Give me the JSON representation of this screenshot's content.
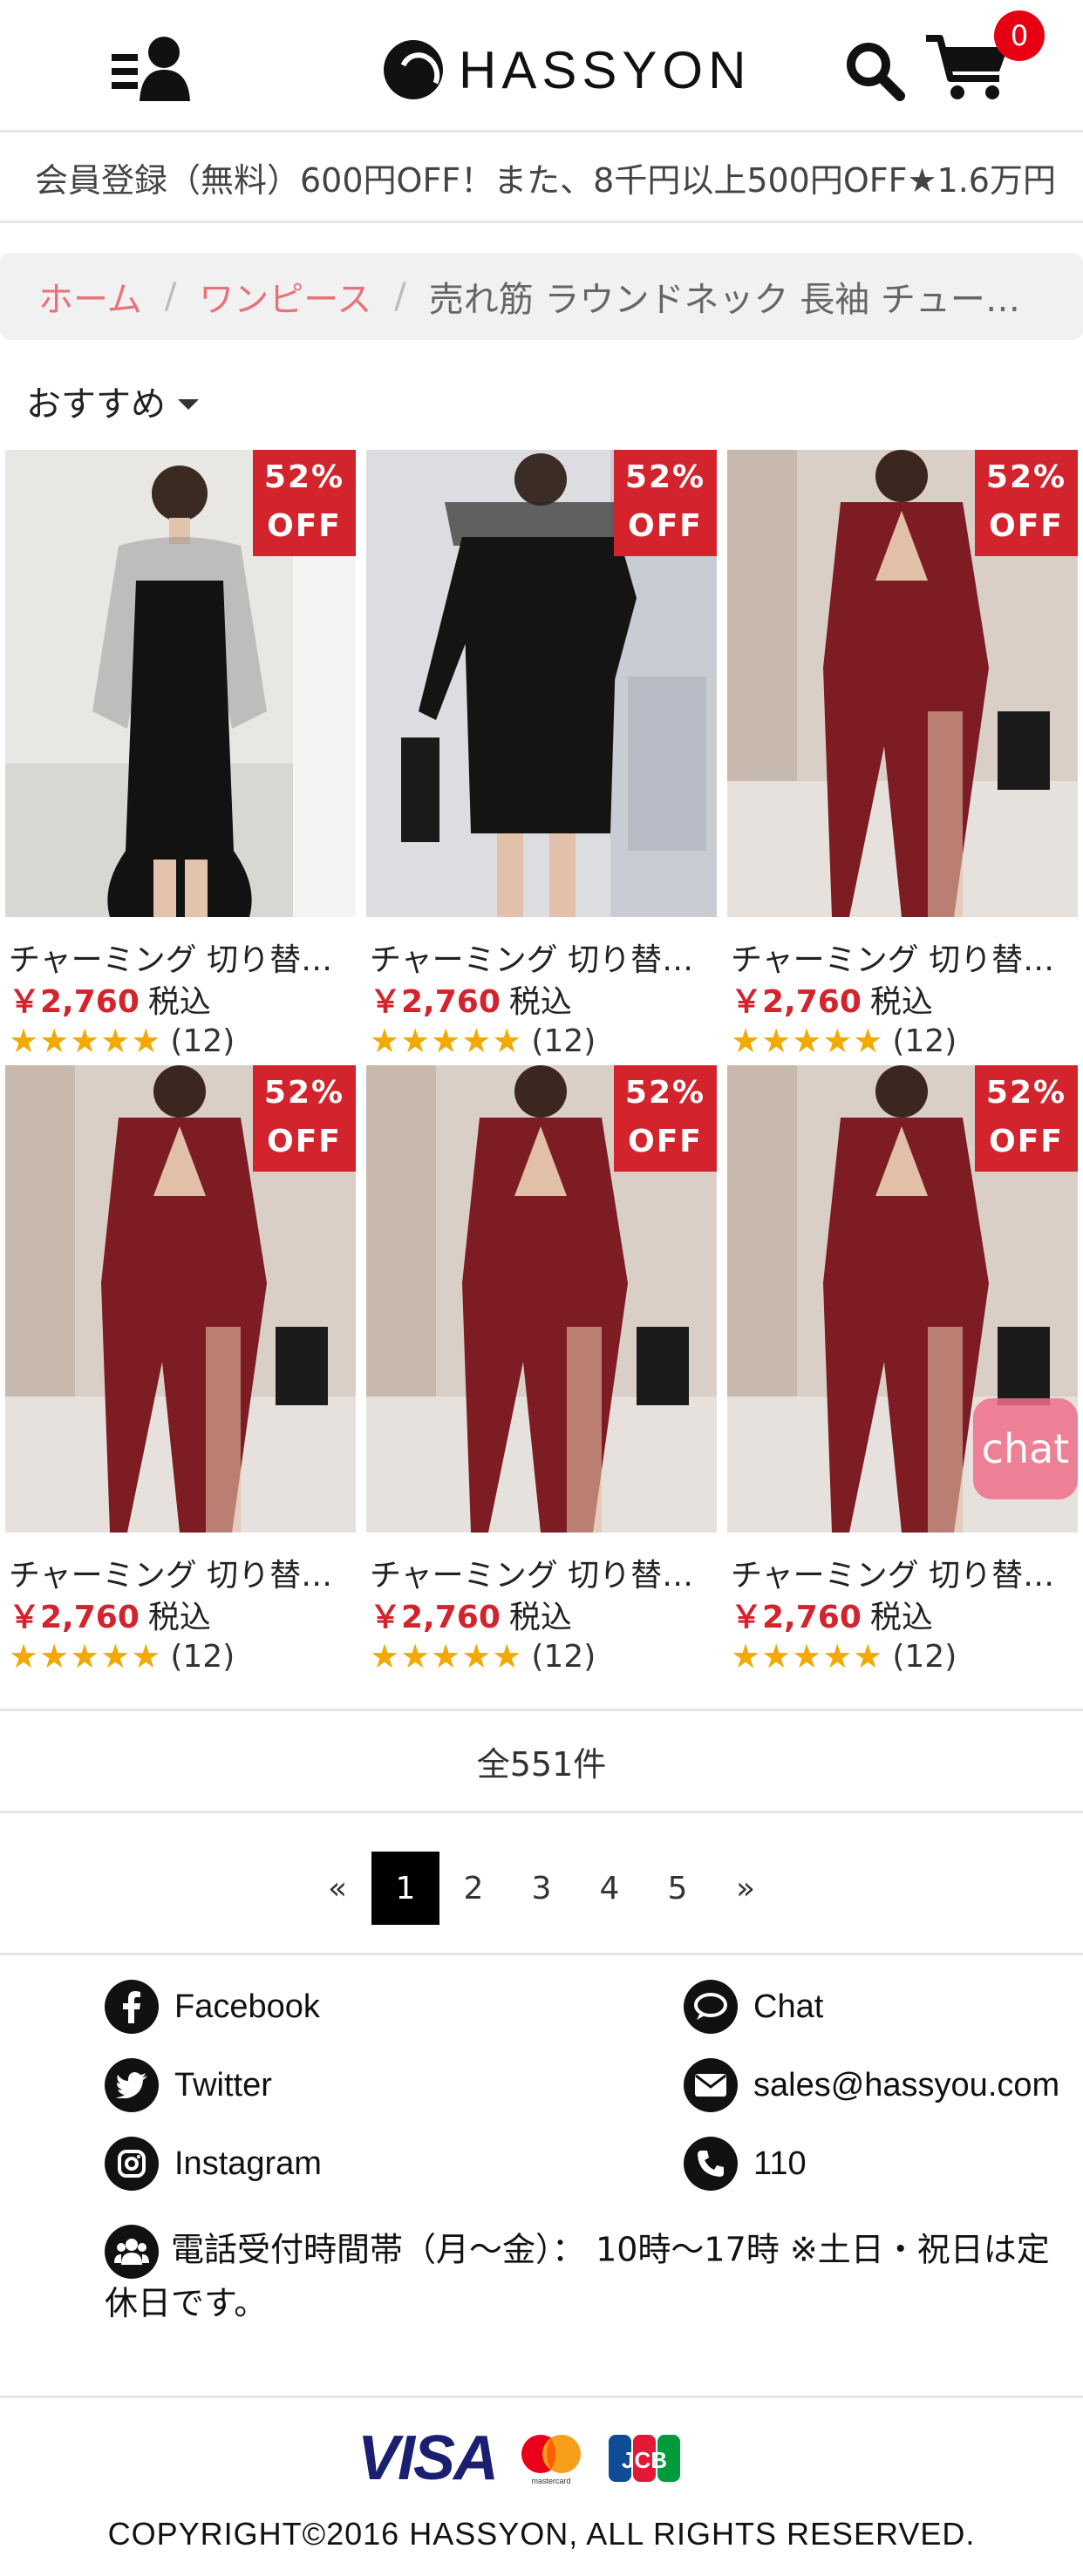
{
  "header": {
    "brand": "HASSYON",
    "cart_count": "0",
    "icons": [
      "user-menu-icon",
      "search-icon",
      "cart-icon"
    ]
  },
  "announcement": "会員登録（無料）600円OFF！また、8千円以上500円OFF★1.6万円",
  "breadcrumb": {
    "home": "ホーム",
    "category": "ワンピース",
    "current": "売れ筋 ラウンドネック 長袖 チュール…"
  },
  "sort": {
    "selected": "おすすめ"
  },
  "products": [
    {
      "title": "チャーミング 切り替…",
      "price": "￥2,760",
      "tax": "税込",
      "discount_line1": "52%",
      "discount_line2": "OFF",
      "stars": "★★★★★",
      "reviews": "(12)",
      "image": "black-mesh-sleeve-dress"
    },
    {
      "title": "チャーミング 切り替…",
      "price": "￥2,760",
      "tax": "税込",
      "discount_line1": "52%",
      "discount_line2": "OFF",
      "stars": "★★★★★",
      "reviews": "(12)",
      "image": "black-lace-offshoulder-dress"
    },
    {
      "title": "チャーミング 切り替…",
      "price": "￥2,760",
      "tax": "税込",
      "discount_line1": "52%",
      "discount_line2": "OFF",
      "stars": "★★★★★",
      "reviews": "(12)",
      "image": "burgundy-wrap-dress"
    },
    {
      "title": "チャーミング 切り替…",
      "price": "￥2,760",
      "tax": "税込",
      "discount_line1": "52%",
      "discount_line2": "OFF",
      "stars": "★★★★★",
      "reviews": "(12)",
      "image": "burgundy-wrap-dress"
    },
    {
      "title": "チャーミング 切り替…",
      "price": "￥2,760",
      "tax": "税込",
      "discount_line1": "52%",
      "discount_line2": "OFF",
      "stars": "★★★★★",
      "reviews": "(12)",
      "image": "burgundy-wrap-dress"
    },
    {
      "title": "チャーミング 切り替…",
      "price": "￥2,760",
      "tax": "税込",
      "discount_line1": "52%",
      "discount_line2": "OFF",
      "stars": "★★★★★",
      "reviews": "(12)",
      "image": "burgundy-wrap-dress"
    }
  ],
  "chat_button": "chat",
  "total": "全551件",
  "pagination": {
    "prev": "«",
    "pages": [
      "1",
      "2",
      "3",
      "4",
      "5"
    ],
    "active": "1",
    "next": "»"
  },
  "footer": {
    "links_left": [
      "Facebook",
      "Twitter",
      "Instagram"
    ],
    "links_right": [
      "Chat",
      "sales@hassyou.com",
      "110"
    ],
    "hours": "電話受付時間帯（月～金）： 10時～17時 ※土日・祝日は定休日です。",
    "payment": {
      "visa": "VISA",
      "mastercard_label": "mastercard",
      "jcb": "JCB"
    },
    "copyright": "COPYRIGHT©2016 HASSYON, ALL RIGHTS RESERVED."
  },
  "colors": {
    "accent_red": "#d3242d",
    "link_pink": "#e8717a",
    "star": "#f2a900",
    "chat_pink": "#ef6f8a"
  }
}
